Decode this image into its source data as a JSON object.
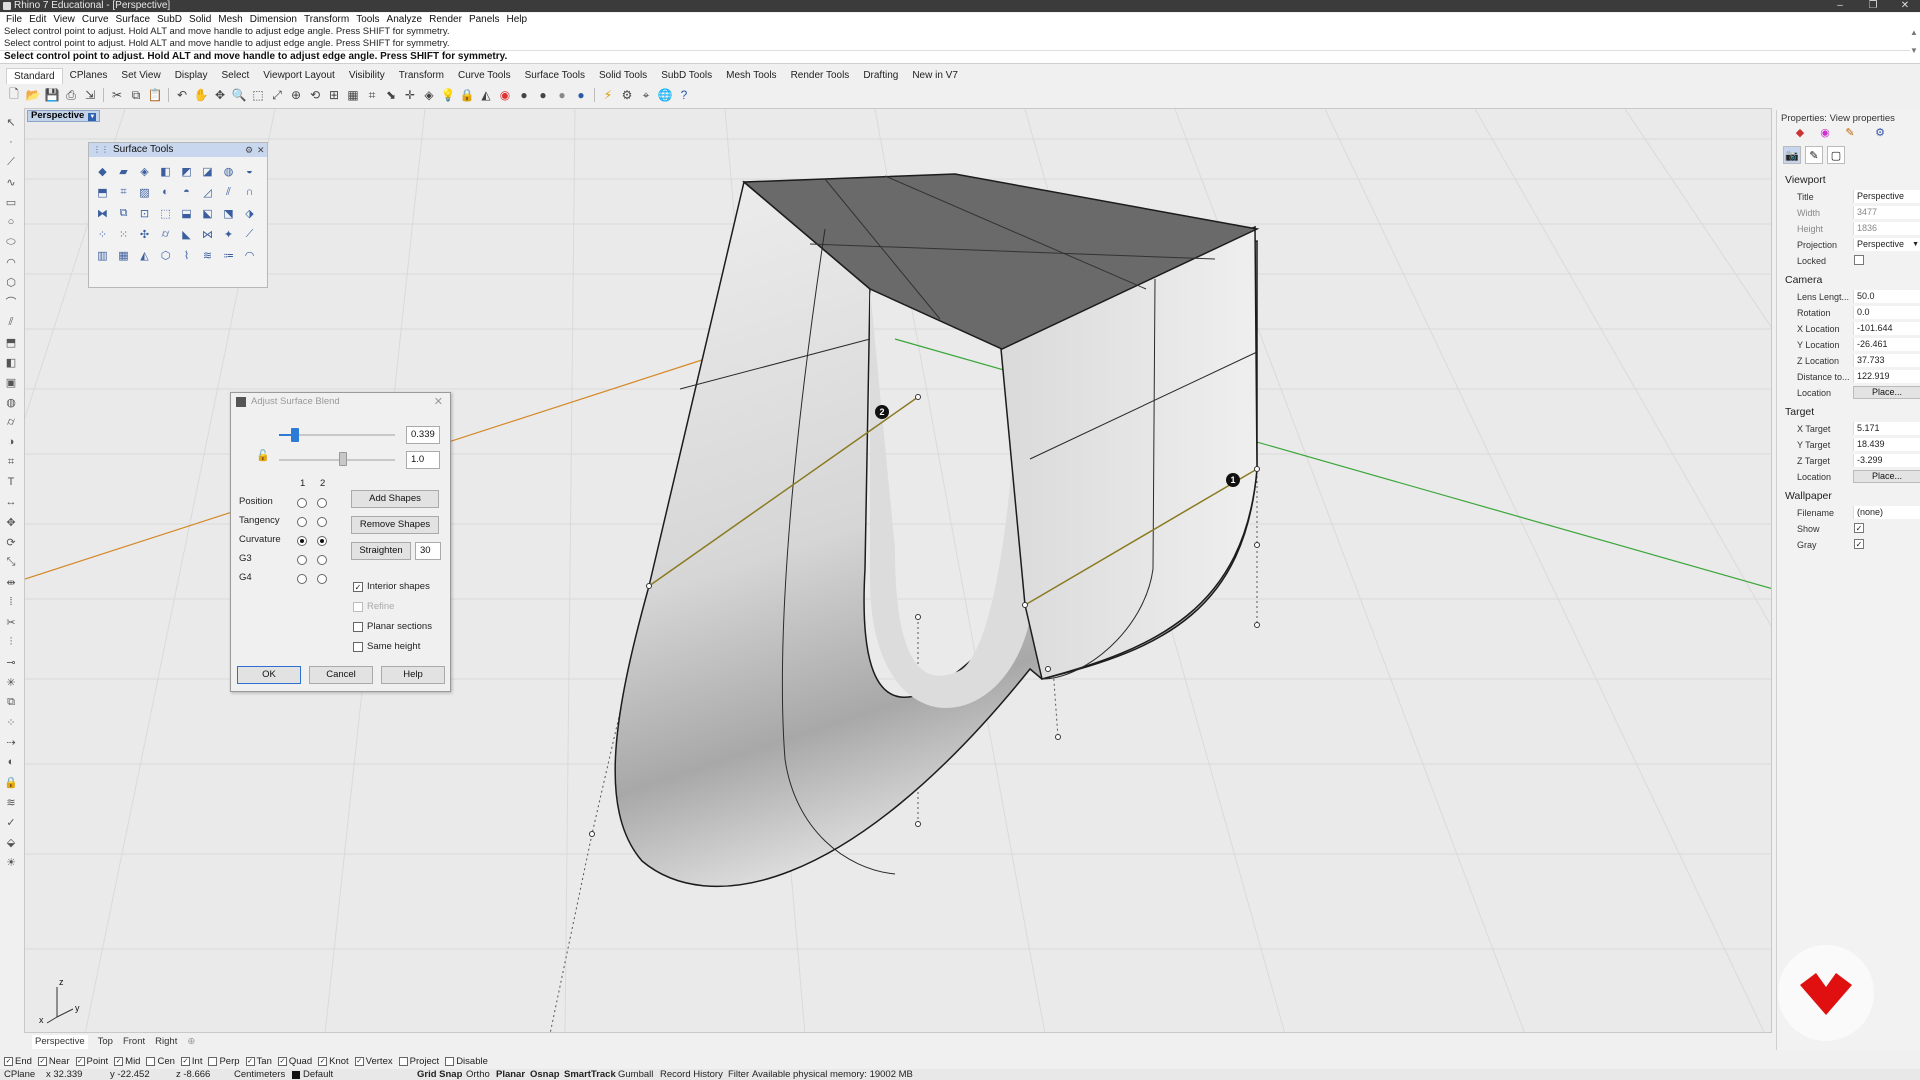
{
  "window": {
    "title": "Rhino 7 Educational - [Perspective]"
  },
  "menu": [
    "File",
    "Edit",
    "View",
    "Curve",
    "Surface",
    "SubD",
    "Solid",
    "Mesh",
    "Dimension",
    "Transform",
    "Tools",
    "Analyze",
    "Render",
    "Panels",
    "Help"
  ],
  "command": {
    "history": [
      "Select control point to adjust. Hold ALT and move handle to adjust edge angle. Press SHIFT for symmetry.",
      "Select control point to adjust. Hold ALT and move handle to adjust edge angle. Press SHIFT for symmetry."
    ],
    "prompt": "Select control point to adjust. Hold ALT and move handle to adjust edge angle. Press SHIFT for symmetry."
  },
  "toolbar_tabs": [
    "Standard",
    "CPlanes",
    "Set View",
    "Display",
    "Select",
    "Viewport Layout",
    "Visibility",
    "Transform",
    "Curve Tools",
    "Surface Tools",
    "Solid Tools",
    "SubD Tools",
    "Mesh Tools",
    "Render Tools",
    "Drafting",
    "New in V7"
  ],
  "viewport": {
    "label": "Perspective",
    "markers": [
      "1",
      "2"
    ],
    "axes": {
      "x": "x",
      "y": "y",
      "z": "z"
    }
  },
  "surface_tools": {
    "title": "Surface Tools"
  },
  "dialog": {
    "title": "Adjust Surface Blend",
    "value1": "0.339",
    "value2": "1.0",
    "slider1_fraction": 0.14,
    "slider2_fraction": 0.55,
    "col1": "1",
    "col2": "2",
    "rows": [
      "Position",
      "Tangency",
      "Curvature",
      "G3",
      "G4"
    ],
    "selected_row": "Curvature",
    "add_shapes": "Add Shapes",
    "remove_shapes": "Remove Shapes",
    "straighten": "Straighten",
    "straighten_value": "30",
    "interior_shapes": "Interior shapes",
    "refine": "Refine",
    "planar_sections": "Planar sections",
    "same_height": "Same height",
    "ok": "OK",
    "cancel": "Cancel",
    "help": "Help"
  },
  "properties": {
    "header": "Properties: View properties",
    "viewport_section": "Viewport",
    "title_label": "Title",
    "title_value": "Perspective",
    "width_label": "Width",
    "width_value": "3477",
    "height_label": "Height",
    "height_value": "1836",
    "projection_label": "Projection",
    "projection_value": "Perspective",
    "locked_label": "Locked",
    "camera_section": "Camera",
    "lens_label": "Lens Lengt...",
    "lens_value": "50.0",
    "rotation_label": "Rotation",
    "rotation_value": "0.0",
    "xloc_label": "X Location",
    "xloc_value": "-101.644",
    "yloc_label": "Y Location",
    "yloc_value": "-26.461",
    "zloc_label": "Z Location",
    "zloc_value": "37.733",
    "dist_label": "Distance to...",
    "dist_value": "122.919",
    "location_label": "Location",
    "place_label": "Place...",
    "target_section": "Target",
    "xt_label": "X Target",
    "xt_value": "5.171",
    "yt_label": "Y Target",
    "yt_value": "18.439",
    "zt_label": "Z Target",
    "zt_value": "-3.299",
    "tloc_label": "Location",
    "tplace_label": "Place...",
    "wallpaper_section": "Wallpaper",
    "filename_label": "Filename",
    "filename_value": "(none)",
    "show_label": "Show",
    "gray_label": "Gray"
  },
  "viewport_tabs": [
    "Perspective",
    "Top",
    "Front",
    "Right"
  ],
  "osnaps": [
    {
      "label": "End",
      "checked": true
    },
    {
      "label": "Near",
      "checked": true
    },
    {
      "label": "Point",
      "checked": true
    },
    {
      "label": "Mid",
      "checked": true
    },
    {
      "label": "Cen",
      "checked": false
    },
    {
      "label": "Int",
      "checked": true
    },
    {
      "label": "Perp",
      "checked": false
    },
    {
      "label": "Tan",
      "checked": true
    },
    {
      "label": "Quad",
      "checked": true
    },
    {
      "label": "Knot",
      "checked": true
    },
    {
      "label": "Vertex",
      "checked": true
    },
    {
      "label": "Project",
      "checked": false
    },
    {
      "label": "Disable",
      "checked": false
    }
  ],
  "status": {
    "cplane": "CPlane",
    "x": "x 32.339",
    "y": "y -22.452",
    "z": "z -8.666",
    "units": "Centimeters",
    "layer": "Default",
    "grid_snap": "Grid Snap",
    "ortho": "Ortho",
    "planar": "Planar",
    "osnap": "Osnap",
    "smarttrack": "SmartTrack",
    "gumball": "Gumball",
    "record_history": "Record History",
    "filter": "Filter",
    "memory": "Available physical memory: 19002 MB"
  },
  "colors": {
    "accent": "#2e7bd6",
    "axis_x": "#d4892a",
    "axis_y": "#3aa63a",
    "logo": "#e01010"
  }
}
